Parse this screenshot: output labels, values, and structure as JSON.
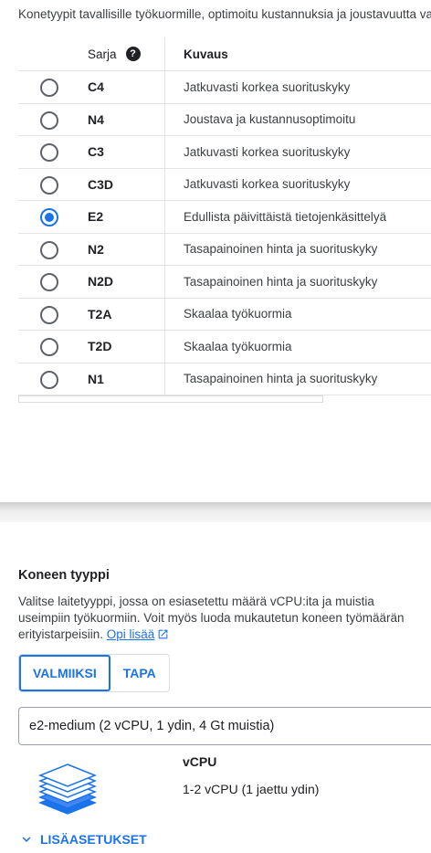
{
  "intro_text": "Konetyypit tavallisille työkuormille, optimoitu kustannuksia ja joustavuutta varten",
  "table": {
    "headers": {
      "series": "Sarja",
      "description": "Kuvaus"
    },
    "rows": [
      {
        "series": "C4",
        "description": "Jatkuvasti korkea suorituskyky",
        "selected": false
      },
      {
        "series": "N4",
        "description": "Joustava ja kustannusoptimoitu",
        "selected": false
      },
      {
        "series": "C3",
        "description": "Jatkuvasti korkea suorituskyky",
        "selected": false
      },
      {
        "series": "C3D",
        "description": "Jatkuvasti korkea suorituskyky",
        "selected": false
      },
      {
        "series": "E2",
        "description": "Edullista päivittäistä tietojenkäsittelyä",
        "selected": true
      },
      {
        "series": "N2",
        "description": "Tasapainoinen hinta ja suorituskyky",
        "selected": false
      },
      {
        "series": "N2D",
        "description": "Tasapainoinen hinta ja suorituskyky",
        "selected": false
      },
      {
        "series": "T2A",
        "description": "Skaalaa työkuormia",
        "selected": false
      },
      {
        "series": "T2D",
        "description": "Skaalaa työkuormia",
        "selected": false
      },
      {
        "series": "N1",
        "description": "Tasapainoinen hinta ja suorituskyky",
        "selected": false
      }
    ]
  },
  "machine_type": {
    "title": "Koneen tyyppi",
    "description_lines": [
      "Valitse laitetyyppi, jossa on esiasetettu määrä vCPU:ita ja muistia",
      "useimpiin työkuormiin. Voit myös luoda mukautetun koneen työmäärän",
      "erityistarpeisiin."
    ],
    "learn_more": "Opi lisää",
    "tabs": [
      "VALMIIKSI",
      "TAPA"
    ],
    "active_tab": "VALMIIKSI",
    "selected_value": "e2-medium (2 vCPU, 1 ydin, 4 Gt muistia)",
    "vcpu_label": "vCPU",
    "vcpu_value": "1-2 vCPU (1 jaettu ydin)",
    "advanced_label": "LISÄASETUKSET"
  },
  "colors": {
    "accent": "#1a73e8",
    "text": "#202124",
    "muted": "#3c4043",
    "border": "#dadce0"
  },
  "icons": {
    "help": "help-circle-icon",
    "external": "open-in-new-icon",
    "stack": "layers-stack-icon",
    "chevron": "chevron-down-icon"
  }
}
